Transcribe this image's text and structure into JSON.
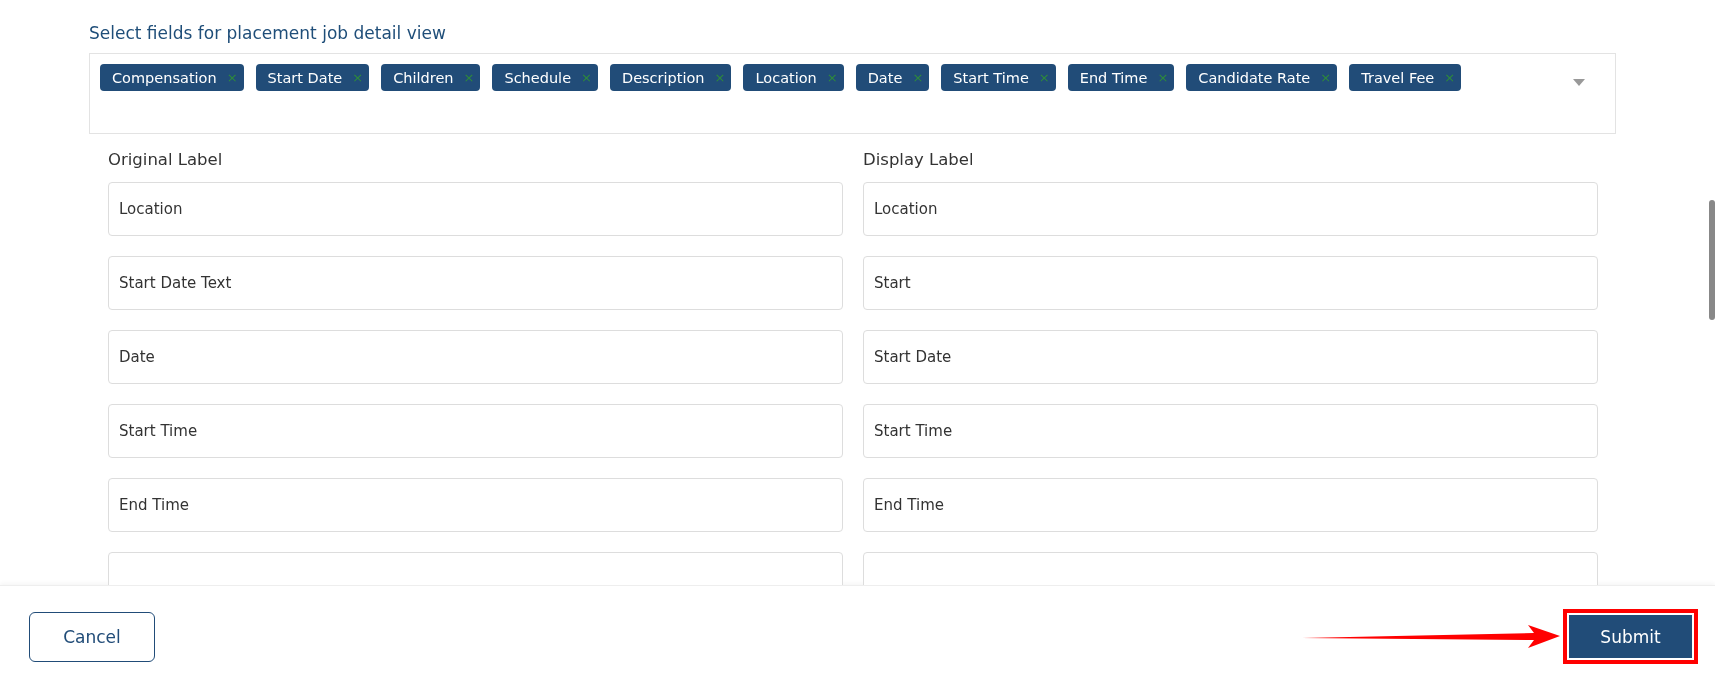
{
  "section_title": "Select fields for placement job detail view",
  "selected_fields": [
    {
      "label": "Compensation",
      "remove": "×"
    },
    {
      "label": "Start Date",
      "remove": "×"
    },
    {
      "label": "Children",
      "remove": "×"
    },
    {
      "label": "Schedule",
      "remove": "×"
    },
    {
      "label": "Description",
      "remove": "×"
    },
    {
      "label": "Location",
      "remove": "×"
    },
    {
      "label": "Date",
      "remove": "×"
    },
    {
      "label": "Start Time",
      "remove": "×"
    },
    {
      "label": "End Time",
      "remove": "×"
    },
    {
      "label": "Candidate Rate",
      "remove": "×"
    },
    {
      "label": "Travel Fee",
      "remove": "×"
    }
  ],
  "columns": [
    "Original Label",
    "Display Label"
  ],
  "rows": [
    {
      "original": "Location",
      "display": "Location"
    },
    {
      "original": "Start Date Text",
      "display": "Start"
    },
    {
      "original": "Date",
      "display": "Start Date"
    },
    {
      "original": "Start Time",
      "display": "Start Time"
    },
    {
      "original": "End Time",
      "display": "End Time"
    },
    {}
  ],
  "buttons": {
    "cancel": "Cancel",
    "submit": "Submit"
  }
}
